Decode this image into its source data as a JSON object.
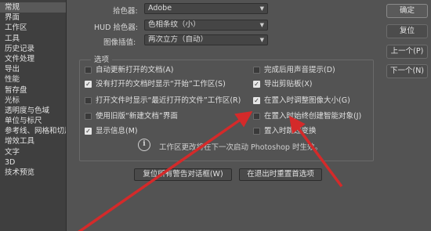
{
  "sidebar": {
    "items": [
      {
        "label": "常规"
      },
      {
        "label": "界面"
      },
      {
        "label": "工作区"
      },
      {
        "label": "工具"
      },
      {
        "label": "历史记录"
      },
      {
        "label": "文件处理"
      },
      {
        "label": "导出"
      },
      {
        "label": "性能"
      },
      {
        "label": "暂存盘"
      },
      {
        "label": "光标"
      },
      {
        "label": "透明度与色域"
      },
      {
        "label": "单位与标尺"
      },
      {
        "label": "参考线、网格和切片"
      },
      {
        "label": "增效工具"
      },
      {
        "label": "文字"
      },
      {
        "label": "3D"
      },
      {
        "label": "技术预览"
      }
    ]
  },
  "color_picker": {
    "label": "拾色器:",
    "value": "Adobe"
  },
  "hud_picker": {
    "label": "HUD 拾色器:",
    "value": "色相条纹（小）"
  },
  "interpolation": {
    "label": "图像插值:",
    "value": "两次立方（自动）"
  },
  "options": {
    "title": "选项",
    "left": [
      {
        "label": "自动更新打开的文档(A)",
        "checked": false
      },
      {
        "label": "没有打开的文档时显示“开始”工作区(S)",
        "checked": true
      },
      {
        "label": "打开文件时显示“最近打开的文件”工作区(R)",
        "checked": false
      },
      {
        "label": "使用旧版“新建文档”界面",
        "checked": false
      },
      {
        "label": "显示信息(M)",
        "checked": true
      }
    ],
    "right": [
      {
        "label": "完成后用声音提示(D)",
        "checked": false
      },
      {
        "label": "导出剪贴板(X)",
        "checked": true
      },
      {
        "label": "在置入时调整图像大小(G)",
        "checked": true
      },
      {
        "label": "在置入时始终创建智能对象(J)",
        "checked": false
      },
      {
        "label": "置入时跳过变换",
        "checked": false
      }
    ],
    "info_icon": "info-circle-icon",
    "info_text": "工作区更改将在下一次启动 Photoshop 时生效。"
  },
  "buttons": {
    "reset_warnings": "复位所有警告对话框(W)",
    "reset_prefs_on_quit": "在退出时重置首选项",
    "ok": "确定",
    "reset": "复位",
    "prev": "上一个(P)",
    "next": "下一个(N)"
  },
  "colors": {
    "background": "#535353",
    "sidebar": "#3f3f3f",
    "annotation_arrow": "#d42a2a"
  }
}
